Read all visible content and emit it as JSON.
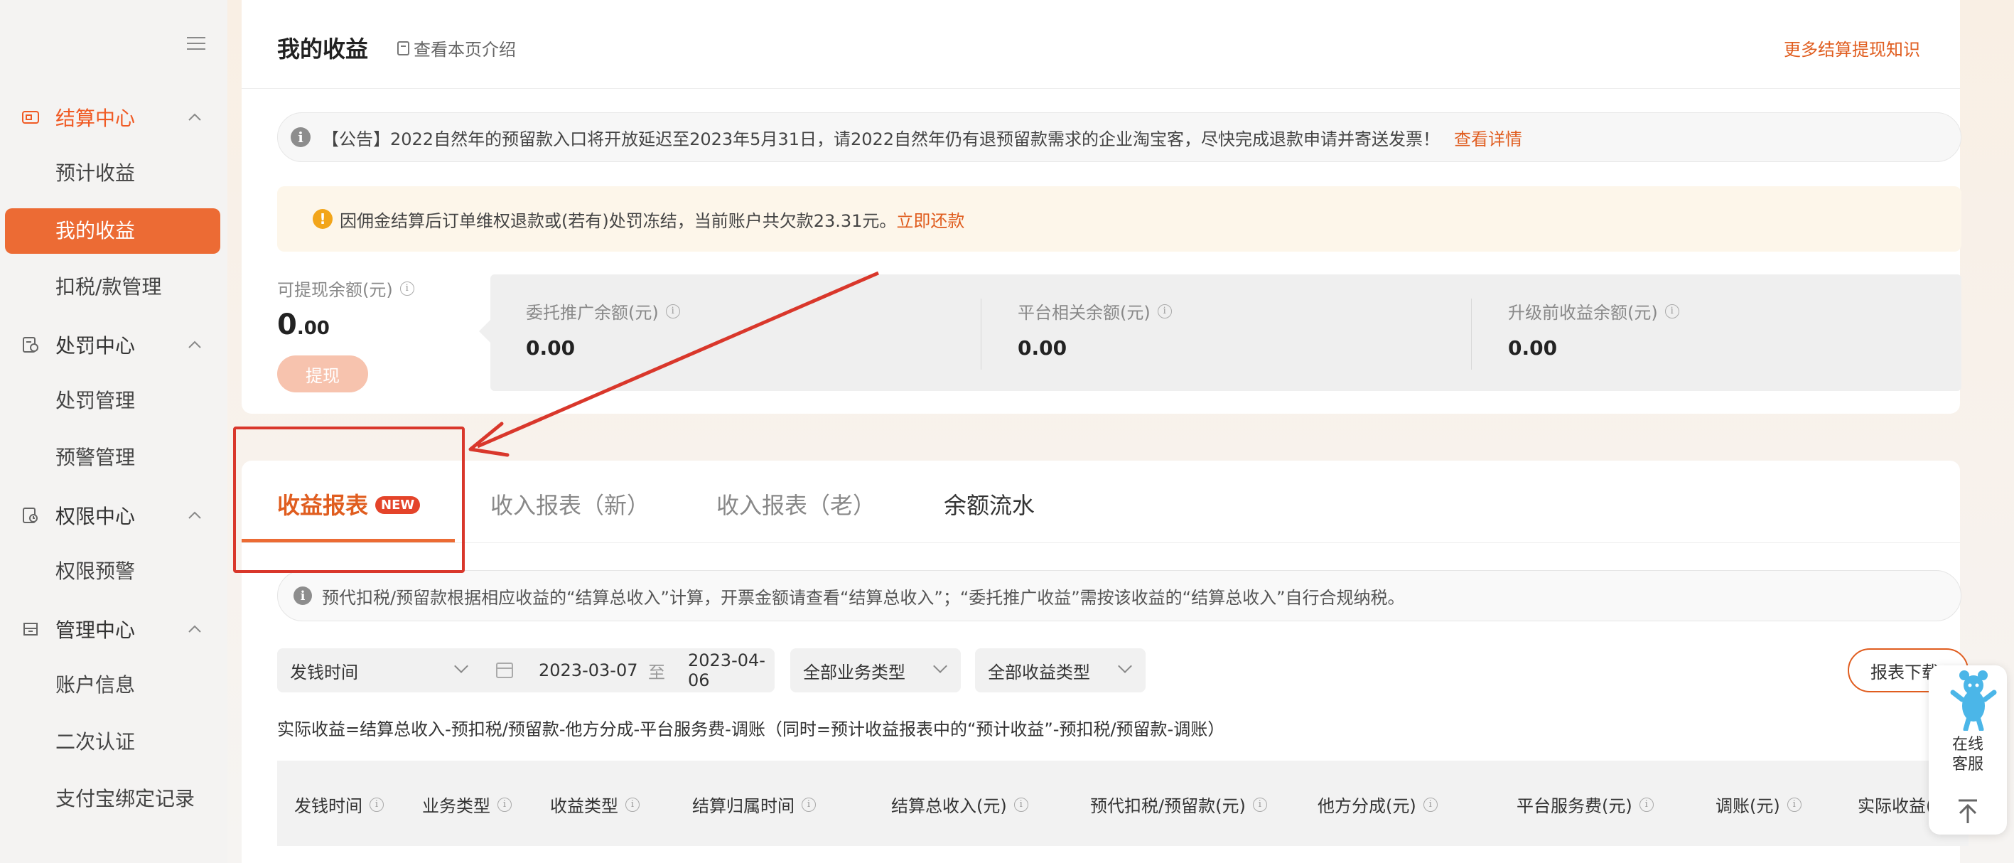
{
  "sidebar": {
    "groups": [
      {
        "label": "结算中心",
        "icon": "settlement-icon",
        "active": true,
        "items": [
          "预计收益",
          "我的收益",
          "扣税/款管理"
        ]
      },
      {
        "label": "处罚中心",
        "icon": "penalty-icon",
        "items": [
          "处罚管理",
          "预警管理"
        ]
      },
      {
        "label": "权限中心",
        "icon": "permission-icon",
        "items": [
          "权限预警"
        ]
      },
      {
        "label": "管理中心",
        "icon": "management-icon",
        "items": [
          "账户信息",
          "二次认证",
          "支付宝绑定记录"
        ]
      }
    ]
  },
  "header": {
    "title": "我的收益",
    "intro_link": "查看本页介绍",
    "more_link": "更多结算提现知识"
  },
  "notice": {
    "icon": "i",
    "text": "【公告】2022自然年的预留款入口将开放延迟至2023年5月31日，请2022自然年仍有退预留款需求的企业淘宝客，尽快完成退款申请并寄送发票！",
    "link": "查看详情"
  },
  "warning": {
    "icon": "!",
    "text": "因佣金结算后订单维权退款或(若有)处罚冻结，当前账户共欠款23.31元。",
    "link": "立即还款"
  },
  "balance": {
    "label": "可提现余额(元)",
    "value_int": "0",
    "value_dec": ".00",
    "withdraw_label": "提现",
    "sub": [
      {
        "label": "委托推广余额(元)",
        "value": "0.00"
      },
      {
        "label": "平台相关余额(元)",
        "value": "0.00"
      },
      {
        "label": "升级前收益余额(元)",
        "value": "0.00"
      }
    ]
  },
  "tabs": [
    {
      "label": "收益报表",
      "badge": "NEW"
    },
    {
      "label": "收入报表（新）"
    },
    {
      "label": "收入报表（老）"
    },
    {
      "label": "余额流水"
    }
  ],
  "tip": "预代扣税/预留款根据相应收益的“结算总收入”计算，开票金额请查看“结算总收入”；“委托推广收益”需按该收益的“结算总收入”自行合规纳税。",
  "filters": {
    "time_type": "发钱时间",
    "start_date": "2023-03-07",
    "to": "至",
    "end_date": "2023-04-06",
    "business_type": "全部业务类型",
    "income_type": "全部收益类型",
    "download": "报表下载"
  },
  "formula": "实际收益=结算总收入-预扣税/预留款-他方分成-平台服务费-调账（同时=预计收益报表中的“预计收益”-预扣税/预留款-调账）",
  "table": {
    "columns": [
      "发钱时间",
      "业务类型",
      "收益类型",
      "结算归属时间",
      "结算总收入(元)",
      "预代扣税/预留款(元)",
      "他方分成(元)",
      "平台服务费(元)",
      "调账(元)",
      "实际收益(元)"
    ]
  },
  "service": {
    "line1": "在线",
    "line2": "客服"
  },
  "colors": {
    "accent": "#ec6b34",
    "link": "#e05d1f",
    "annotation": "#d9372b"
  }
}
